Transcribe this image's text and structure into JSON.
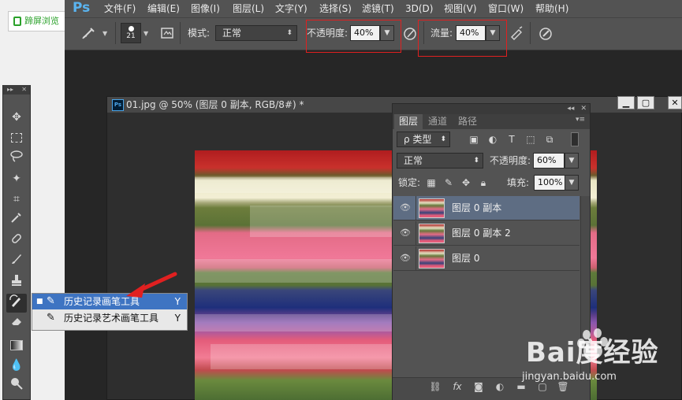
{
  "browser": {
    "tab_label": "蹄屏浏览"
  },
  "app": {
    "logo": "Ps"
  },
  "menu": {
    "items": [
      "文件(F)",
      "编辑(E)",
      "图像(I)",
      "图层(L)",
      "文字(Y)",
      "选择(S)",
      "滤镜(T)",
      "3D(D)",
      "视图(V)",
      "窗口(W)",
      "帮助(H)"
    ]
  },
  "options": {
    "brush_size": "21",
    "mode_label": "模式:",
    "mode_value": "正常",
    "opacity_label": "不透明度:",
    "opacity_value": "40%",
    "flow_label": "流量:",
    "flow_value": "40%"
  },
  "flyout": {
    "items": [
      {
        "label": "历史记录画笔工具",
        "key": "Y",
        "selected": true
      },
      {
        "label": "历史记录艺术画笔工具",
        "key": "Y",
        "selected": false
      }
    ]
  },
  "document": {
    "title": "01.jpg @ 50% (图层 0 副本, RGB/8#) *",
    "icon": "Ps"
  },
  "layers_panel": {
    "tabs": [
      "图层",
      "通道",
      "路径"
    ],
    "filter_label": "ρ 类型",
    "blend_mode": "正常",
    "opacity_label": "不透明度:",
    "opacity_value": "60%",
    "lock_label": "锁定:",
    "fill_label": "填充:",
    "fill_value": "100%",
    "layers": [
      {
        "name": "图层 0 副本",
        "selected": true
      },
      {
        "name": "图层 0 副本 2",
        "selected": false
      },
      {
        "name": "图层 0",
        "selected": false
      }
    ]
  },
  "watermark": {
    "brand": "Bai度经验",
    "url": "jingyan.baidu.com"
  },
  "colors": {
    "highlight_box": "#e02020",
    "arrow": "#e02020",
    "selection": "#3e74c2"
  }
}
